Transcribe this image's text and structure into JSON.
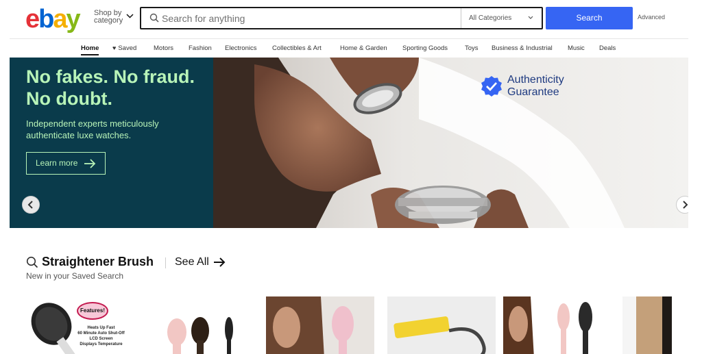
{
  "header": {
    "logo": {
      "e": "e",
      "b": "b",
      "a": "a",
      "y": "y"
    },
    "shop_by_category": "Shop by category",
    "search": {
      "placeholder": "Search for anything",
      "value": ""
    },
    "category_select": "All Categories",
    "search_button": "Search",
    "advanced": "Advanced"
  },
  "nav": {
    "items": [
      "Home",
      "Saved",
      "Motors",
      "Fashion",
      "Electronics",
      "Collectibles & Art",
      "Home & Garden",
      "Sporting Goods",
      "Toys",
      "Business & Industrial",
      "Music",
      "Deals"
    ]
  },
  "hero": {
    "title": "No fakes. No fraud. No doubt.",
    "subtitle": "Independent experts meticulously authenticate luxe watches.",
    "cta": "Learn more",
    "badge": "Authenticity Guarantee",
    "colors": {
      "panel": "#0a3b4b",
      "text": "#b8f4b8",
      "badge": "#1e3a80"
    }
  },
  "section": {
    "title": "Straightener Brush",
    "see_all": "See All",
    "subtitle": "New in your Saved Search"
  },
  "cards": {
    "card1": {
      "burst": "Features!",
      "lines": "Heats Up Fast\n60 Minute Auto Shut-Off\nLCD Screen\nDisplays Temperature"
    }
  },
  "icons": [
    "search-icon",
    "chevron-down-icon",
    "heart-icon",
    "arrow-right-icon",
    "chevron-left-icon",
    "chevron-right-icon",
    "pause-icon",
    "checkmark-badge-icon"
  ],
  "accent": {
    "search_button": "#3665f3"
  }
}
